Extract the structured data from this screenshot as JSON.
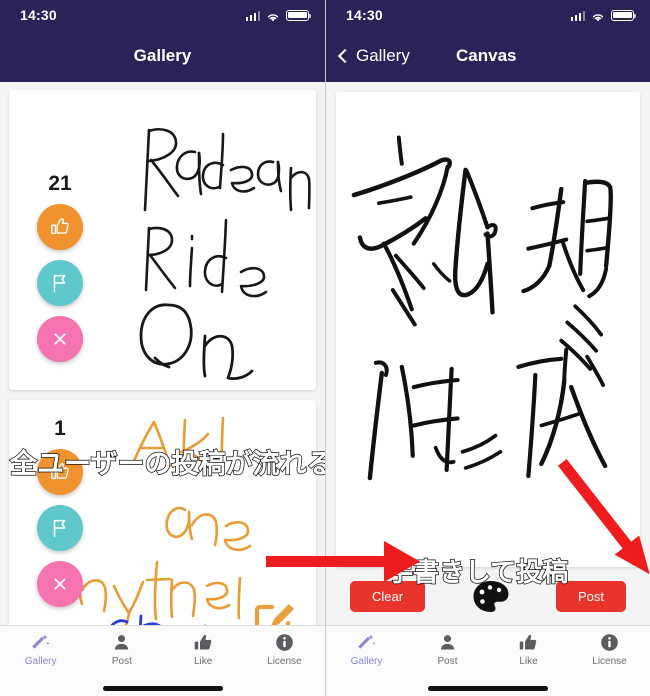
{
  "left_screen": {
    "status": {
      "time": "14:30",
      "signal_icon": "cellular-bars-icon",
      "wifi_icon": "wifi-icon",
      "battery_icon": "battery-icon"
    },
    "navbar": {
      "title": "Gallery"
    },
    "cards": [
      {
        "like_count": "21",
        "like_icon": "thumbs-up-icon",
        "flag_icon": "flag-icon",
        "close_icon": "close-x-icon",
        "handwriting_text": "Radeon Ride On",
        "ink_color": "#181818"
      },
      {
        "like_count": "1",
        "like_icon": "thumbs-up-icon",
        "flag_icon": "flag-icon",
        "close_icon": "close-x-icon",
        "handwriting_text": "Ask me anything",
        "ink_color": "#e89c35",
        "secondary_ink_color": "#2a3bd0"
      }
    ],
    "compose_button": {
      "icon": "compose-edit-icon",
      "color": "#e8a13a"
    },
    "annotation": "全ユーザーの投稿が流れる"
  },
  "right_screen": {
    "status": {
      "time": "14:30",
      "signal_icon": "cellular-bars-icon",
      "wifi_icon": "wifi-icon",
      "battery_icon": "battery-icon"
    },
    "navbar": {
      "back_label": "Gallery",
      "back_icon": "chevron-left-icon",
      "title": "Canvas"
    },
    "canvas": {
      "handwriting_text": "新規作成",
      "ink_color": "#111111"
    },
    "toolbar": {
      "clear_label": "Clear",
      "post_label": "Post",
      "palette_icon": "palette-icon",
      "button_color": "#e8342a"
    },
    "annotation": "手書きして投稿"
  },
  "tabbar": {
    "items": [
      {
        "label": "Gallery",
        "icon": "magic-wand-icon",
        "active": true
      },
      {
        "label": "Post",
        "icon": "person-icon",
        "active": false
      },
      {
        "label": "Like",
        "icon": "thumbs-up-icon",
        "active": false
      },
      {
        "label": "License",
        "icon": "info-circle-icon",
        "active": false
      }
    ],
    "active_color": "#8b85d4",
    "inactive_color": "#6e6e73"
  },
  "theme": {
    "navbar_color": "#2b2358",
    "background_color": "#f4f4f4",
    "accent_orange": "#f0922e",
    "accent_teal": "#5ec8cd",
    "accent_pink": "#f573ae",
    "annotation_arrow_color": "#ee1c1c"
  }
}
